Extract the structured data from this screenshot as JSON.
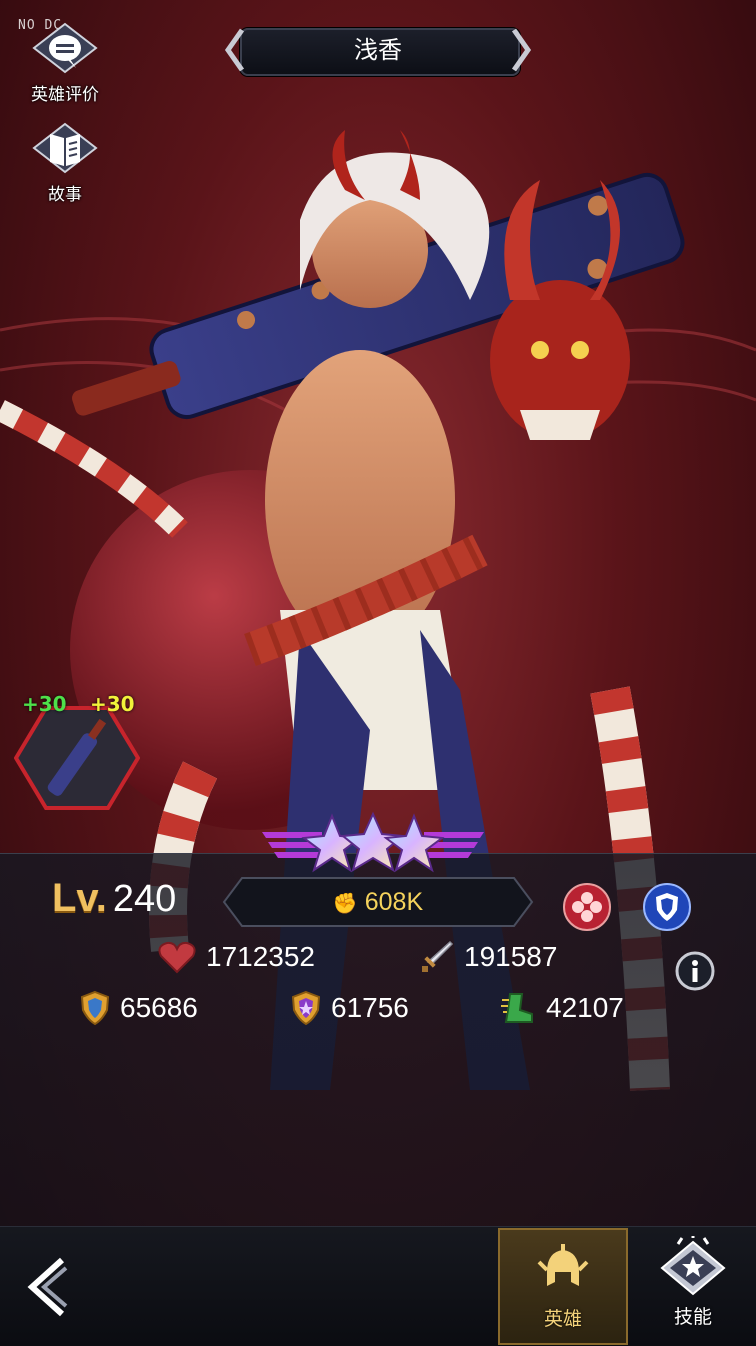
{
  "watermark": "NO DC",
  "header": {
    "hero_name": "浅香"
  },
  "side_menu": {
    "review_label": "英雄评价",
    "story_label": "故事"
  },
  "weapon": {
    "bonus_left": "+30",
    "bonus_right": "+30",
    "bonus_left_color": "#4ee04a",
    "bonus_right_color": "#f2f23a"
  },
  "hero": {
    "level_tag": "Lv.",
    "level": "240",
    "star_count": 3,
    "power": "608K",
    "stats": {
      "hp": "1712352",
      "attack": "191587",
      "defense": "65686",
      "magic_defense": "61756",
      "speed": "42107"
    }
  },
  "nav": {
    "hero_label": "英雄",
    "skill_label": "技能"
  },
  "colors": {
    "accent_gold": "#f5d35c",
    "active_tab": "#f3d27a"
  }
}
